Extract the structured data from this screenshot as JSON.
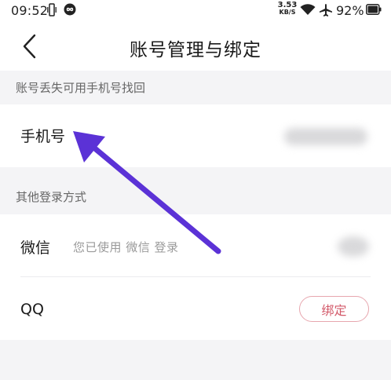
{
  "status_bar": {
    "time": "09:52",
    "net_speed_value": "3.53",
    "net_speed_unit": "KB/S",
    "battery": "92%",
    "icons": [
      "vibrate-icon",
      "loop-icon",
      "wifi-icon",
      "airplane-mode-icon",
      "battery-icon"
    ]
  },
  "header": {
    "title": "账号管理与绑定",
    "back_icon": "chevron-left-icon"
  },
  "section_recovery": {
    "label": "账号丢失可用手机号找回",
    "phone_row": {
      "label": "手机号"
    }
  },
  "section_other": {
    "label": "其他登录方式",
    "wechat_row": {
      "label": "微信",
      "hint": "您已使用 微信 登录"
    },
    "qq_row": {
      "label": "QQ",
      "bind_label": "绑定"
    }
  },
  "annotation": {
    "arrow_color": "#5b32d6",
    "points_to": "phone-row"
  },
  "colors": {
    "background": "#f4f4f6",
    "accent": "#d35a6a",
    "accent_border": "#e7a6ae"
  }
}
